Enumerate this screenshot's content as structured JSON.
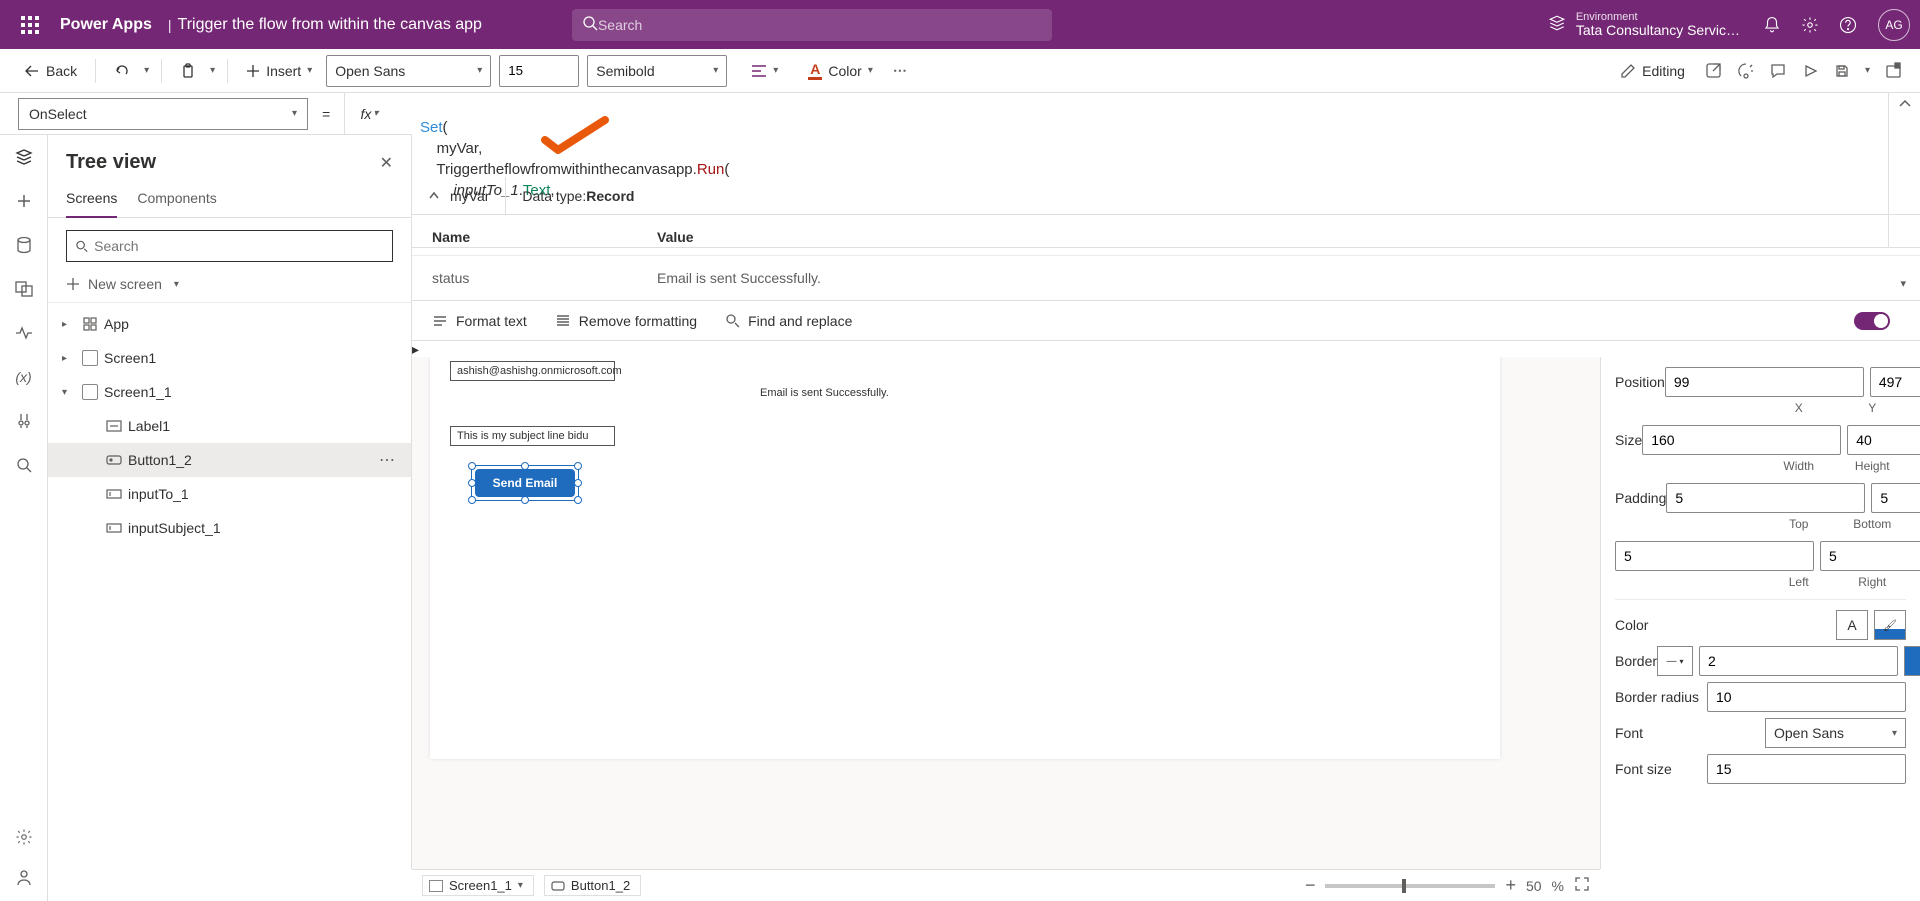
{
  "header": {
    "app_name": "Power Apps",
    "separator": "|",
    "page_title": "Trigger the flow from within the canvas app",
    "search_placeholder": "Search",
    "env_label": "Environment",
    "env_name": "Tata Consultancy Servic…",
    "avatar_initials": "AG"
  },
  "cmdbar": {
    "back": "Back",
    "insert": "Insert",
    "font_family": "Open Sans",
    "font_size": "15",
    "font_weight": "Semibold",
    "color_label": "Color",
    "editing": "Editing"
  },
  "formula": {
    "property": "OnSelect",
    "fx": "fx",
    "code": {
      "l1_fn": "Set",
      "l1_rest": "(",
      "l2": "    myVar,",
      "l3_pre": "    Triggertheflowfromwithinthecanvasapp",
      "l3_dot": ".",
      "l3_run": "Run",
      "l3_post": "(",
      "l4_pre": "        ",
      "l4_var": "inputTo_1",
      "l4_dot": ".",
      "l4_prop": "Text",
      "l4_post": ","
    },
    "result_var": "myVar",
    "data_type_label": "Data type: ",
    "data_type": "Record",
    "table": {
      "name_hdr": "Name",
      "value_hdr": "Value",
      "row_name": "status",
      "row_value": "Email is sent Successfully."
    },
    "format_text": "Format text",
    "remove_formatting": "Remove formatting",
    "find_replace": "Find and replace"
  },
  "tree": {
    "title": "Tree view",
    "tab_screens": "Screens",
    "tab_components": "Components",
    "search_placeholder": "Search",
    "new_screen": "New screen",
    "items": {
      "app": "App",
      "screen1": "Screen1",
      "screen1_1": "Screen1_1",
      "label1": "Label1",
      "button1_2": "Button1_2",
      "inputTo_1": "inputTo_1",
      "inputSubject_1": "inputSubject_1"
    }
  },
  "canvas": {
    "to_value": "ashish@ashishg.onmicrosoft.com",
    "subject_value": "This is my subject line bidu",
    "status_text": "Email is sent Successfully.",
    "button_text": "Send Email"
  },
  "props": {
    "position": "Position",
    "x": "99",
    "y": "497",
    "x_lbl": "X",
    "y_lbl": "Y",
    "size": "Size",
    "w": "160",
    "h": "40",
    "w_lbl": "Width",
    "h_lbl": "Height",
    "padding": "Padding",
    "pt": "5",
    "pb": "5",
    "pl": "5",
    "pr": "5",
    "top": "Top",
    "bottom": "Bottom",
    "left": "Left",
    "right": "Right",
    "color": "Color",
    "border": "Border",
    "border_width": "2",
    "border_radius": "Border radius",
    "radius_v": "10",
    "font": "Font",
    "font_v": "Open Sans",
    "font_size": "Font size",
    "font_size_v": "15"
  },
  "breadcrumb": {
    "screen": "Screen1_1",
    "button": "Button1_2",
    "zoom": "50",
    "zoom_unit": "%"
  }
}
